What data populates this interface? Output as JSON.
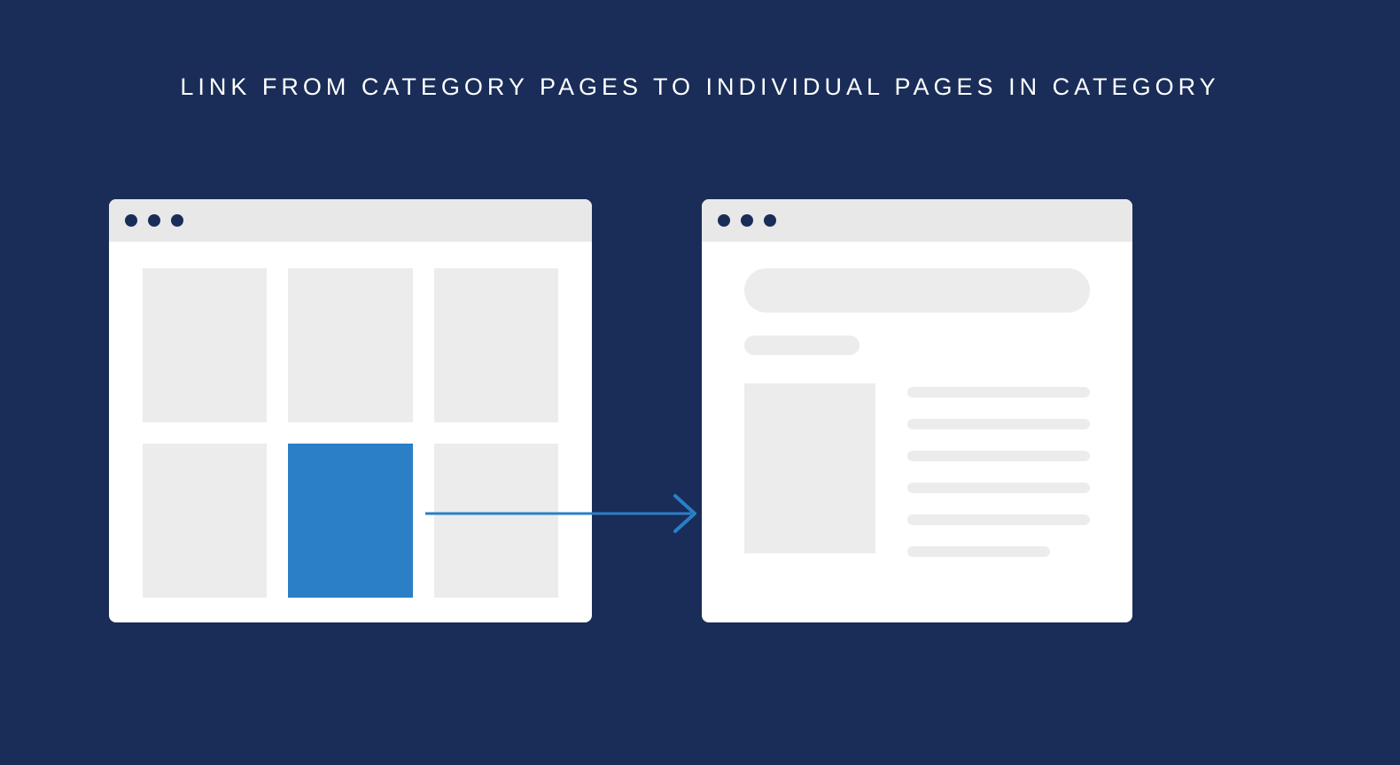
{
  "title": "LINK FROM CATEGORY PAGES TO INDIVIDUAL PAGES IN CATEGORY",
  "colors": {
    "background": "#192d58",
    "accent": "#2a7fc7",
    "placeholder": "#ececec",
    "chrome": "#e8e8e8"
  },
  "left_window": {
    "name": "category-page",
    "grid": {
      "rows": 2,
      "cols": 3,
      "active_index": 4
    }
  },
  "right_window": {
    "name": "individual-page"
  },
  "arrow": {
    "from": "category-page.grid.active",
    "to": "individual-page"
  }
}
